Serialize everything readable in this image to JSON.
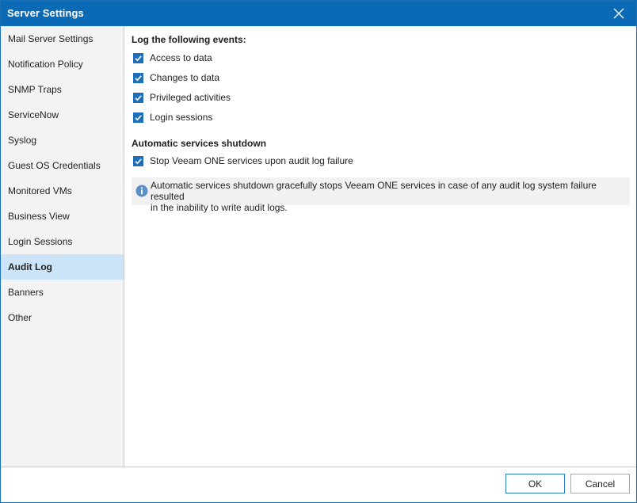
{
  "window": {
    "title": "Server Settings"
  },
  "sidebar": {
    "items": [
      {
        "label": "Mail Server Settings"
      },
      {
        "label": "Notification Policy"
      },
      {
        "label": "SNMP Traps"
      },
      {
        "label": "ServiceNow"
      },
      {
        "label": "Syslog"
      },
      {
        "label": "Guest OS Credentials"
      },
      {
        "label": "Monitored VMs"
      },
      {
        "label": "Business View"
      },
      {
        "label": "Login Sessions"
      },
      {
        "label": "Audit Log",
        "selected": true
      },
      {
        "label": "Banners"
      },
      {
        "label": "Other"
      }
    ]
  },
  "main": {
    "log_events": {
      "heading": "Log the following events:",
      "options": [
        {
          "label": "Access to data",
          "checked": true
        },
        {
          "label": "Changes to data",
          "checked": true
        },
        {
          "label": "Privileged activities",
          "checked": true
        },
        {
          "label": "Login sessions",
          "checked": true
        }
      ]
    },
    "shutdown": {
      "heading": "Automatic services shutdown",
      "option": {
        "label": "Stop Veeam ONE services upon audit log failure",
        "checked": true
      },
      "info_line1": "Automatic services shutdown gracefully stops Veeam ONE services in case of any audit log system failure resulted",
      "info_line2": "in the inability to write audit logs."
    }
  },
  "footer": {
    "ok_label": "OK",
    "cancel_label": "Cancel"
  },
  "colors": {
    "titlebar": "#0a6ab6",
    "selected_item": "#cce4f7",
    "checkbox": "#1f6fb8",
    "info_icon": "#5b8fc7"
  },
  "icons": {
    "close": "close-icon",
    "checkbox": "checkmark-icon",
    "info": "info-icon"
  }
}
